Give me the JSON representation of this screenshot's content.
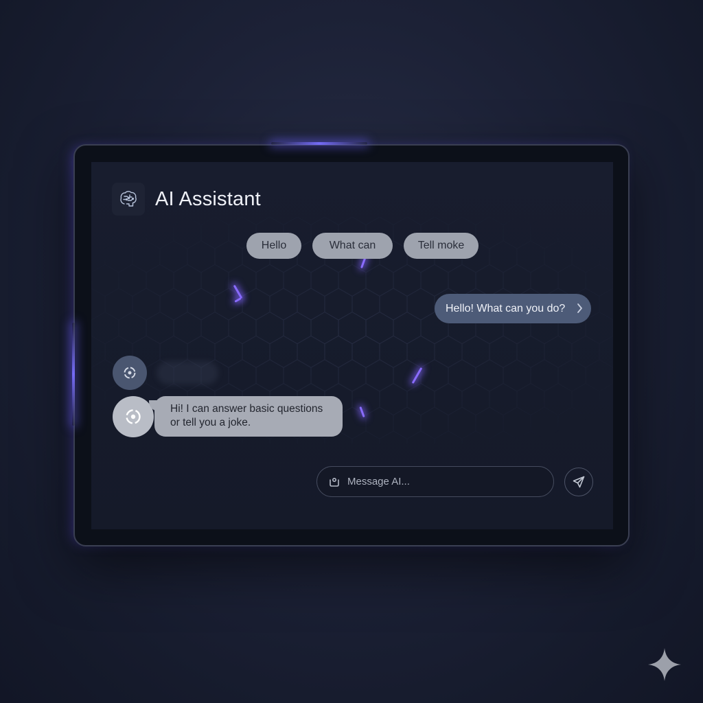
{
  "app": {
    "title": "AI Assistant",
    "icon": "brain-circuit-icon"
  },
  "suggestions": [
    {
      "label": "Hello"
    },
    {
      "label": "What can"
    },
    {
      "label": "Tell moke"
    }
  ],
  "conversation": {
    "user_message": "Hello! What can you do?",
    "ai_message_line1": "Hi! I can answer basic questions",
    "ai_message_line2": "or tell you a joke."
  },
  "composer": {
    "placeholder": "Message AI...",
    "attach_icon": "attachment-icon",
    "send_icon": "send-icon"
  },
  "colors": {
    "accent_glow": "#8a6cff",
    "user_bubble": "#4d5b78",
    "ai_bubble": "#a7abb5",
    "chip": "#9ea3ae",
    "screen_bg": "#181d2e"
  }
}
